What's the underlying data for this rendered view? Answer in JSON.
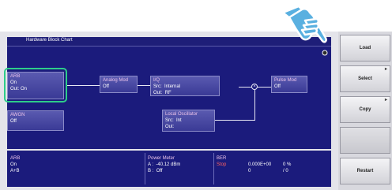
{
  "window": {
    "title": "Hardware Block Chart"
  },
  "blocks": {
    "arb": {
      "title": "ARB",
      "line1": "On",
      "out_label": "Out:",
      "out_value": "On"
    },
    "awgn": {
      "title": "AWGN",
      "line1": "Off"
    },
    "analog_mod": {
      "title": "Analog Mod",
      "line1": "Off"
    },
    "iq": {
      "title": "I/Q",
      "src_label": "Src:",
      "src_value": "Internal",
      "out_label": "Out:",
      "out_value": "RF"
    },
    "local_osc": {
      "title": "Local Oscillator",
      "src_label": "Src:",
      "src_value": "Int",
      "out_label": "Out:"
    },
    "pulse_mod": {
      "title": "Pulse Mod",
      "line1": "Off"
    },
    "mixer_symbol": "×"
  },
  "status": {
    "arb": {
      "title": "ARB",
      "line1": "On",
      "line2": "A+B"
    },
    "power_meter": {
      "title": "Power Meter",
      "a_label": "A :",
      "a_value": "-40.12 dBm",
      "b_label": "B :",
      "b_value": "Off"
    },
    "ber": {
      "title": "BER",
      "stop_label": "Stop",
      "value1": "0.000E+00",
      "value2": "0 %",
      "count1": "0",
      "count2": "/ 0"
    }
  },
  "softkeys": [
    {
      "label": "Load"
    },
    {
      "label": "Select"
    },
    {
      "label": "Copy"
    },
    {
      "label": ""
    },
    {
      "label": "Restart"
    }
  ],
  "colors": {
    "screen_bg": "#1b1b7c",
    "block": "#4a4aa4",
    "highlight": "#2ecc8a",
    "hand": "#5ab0e0"
  }
}
